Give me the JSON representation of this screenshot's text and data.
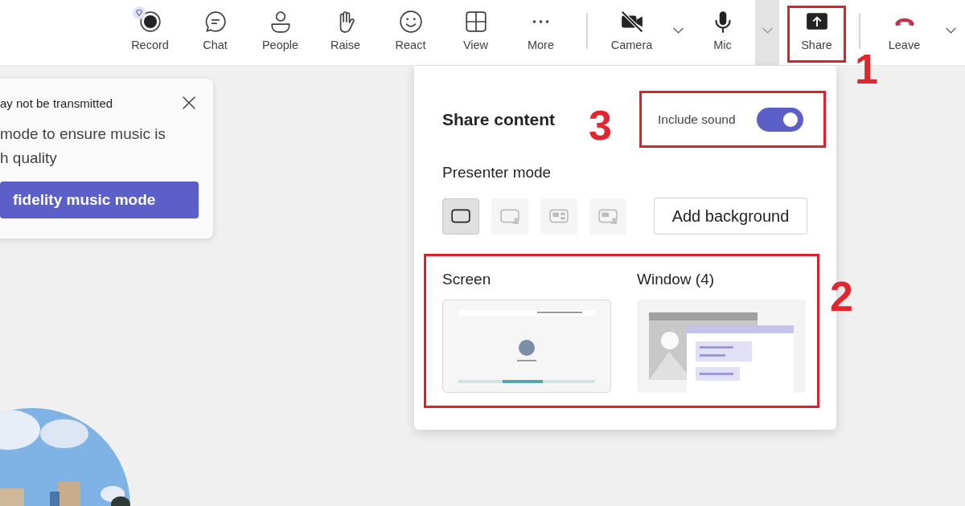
{
  "toolbar": {
    "groups": [
      [
        {
          "label": "Record",
          "premium": true
        },
        {
          "label": "Chat"
        },
        {
          "label": "People"
        },
        {
          "label": "Raise"
        },
        {
          "label": "React"
        },
        {
          "label": "View"
        },
        {
          "label": "More"
        }
      ],
      [
        {
          "label": "Camera",
          "off": true,
          "caret": {
            "pressed": false
          }
        },
        {
          "label": "Mic",
          "caret": {
            "pressed": true
          }
        },
        {
          "label": "Share",
          "annotation": "1"
        }
      ],
      [
        {
          "label": "Leave",
          "caret": {
            "pressed": false
          }
        }
      ]
    ]
  },
  "notification": {
    "title": "ay not be transmitted",
    "body_lines": [
      "mode to ensure music is",
      "h quality"
    ],
    "button": "fidelity music mode"
  },
  "share_panel": {
    "title": "Share content",
    "include_sound": {
      "label": "Include sound",
      "on": true,
      "annotation": "3"
    },
    "presenter_mode": {
      "label": "Presenter mode",
      "modes": [
        {
          "selected": true
        },
        {
          "selected": false
        },
        {
          "selected": false
        },
        {
          "selected": false
        }
      ],
      "add_background": "Add background"
    },
    "sources": {
      "annotation": "2",
      "items": [
        {
          "label": "Screen",
          "kind": "screen"
        },
        {
          "label": "Window (4)",
          "kind": "window"
        }
      ]
    }
  }
}
